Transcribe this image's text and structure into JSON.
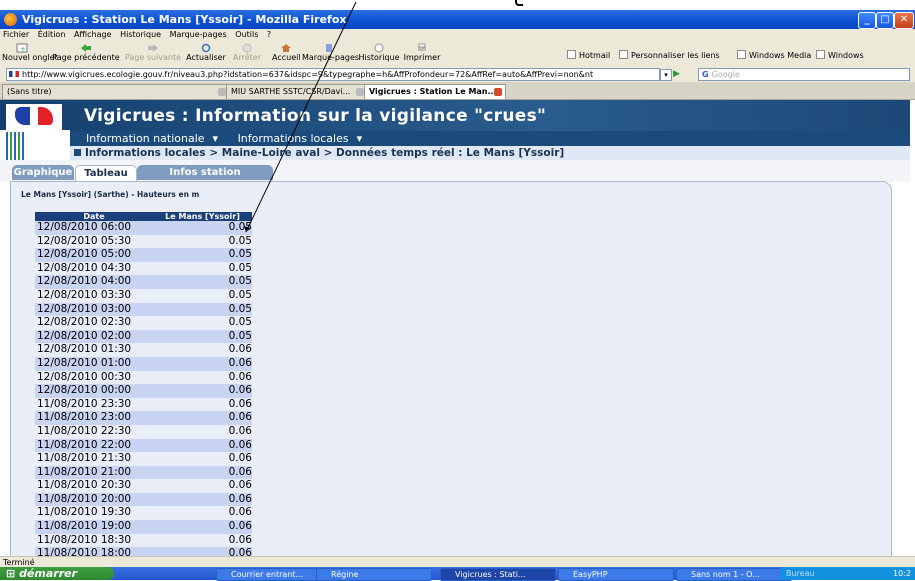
{
  "window": {
    "title": "Vigicrues : Station Le Mans [Yssoir] - Mozilla Firefox"
  },
  "menu": [
    "Fichier",
    "Édition",
    "Affichage",
    "Historique",
    "Marque-pages",
    "Outils",
    "?"
  ],
  "toolbar": {
    "new_tab": "Nouvel onglet",
    "back": "Page précédente",
    "forward": "Page suivante",
    "reload": "Actualiser",
    "stop": "Arrêter",
    "home": "Accueil",
    "bookmarks": "Marque-pages",
    "history": "Historique",
    "print": "Imprimer",
    "links": [
      "Hotmail",
      "Personnaliser les liens",
      "Windows Media",
      "Windows"
    ]
  },
  "url": "http://www.vigicrues.ecologie.gouv.fr/niveau3.php?idstation=637&idspc=9&typegraphe=h&AffProfondeur=72&AffRef=auto&AffPrevi=non&nt",
  "search_placeholder": "Google",
  "browser_tabs": [
    {
      "label": "(Sans titre)"
    },
    {
      "label": "MIU SARTHE SSTC/CSR/Davi..."
    },
    {
      "label": "Vigicrues : Station Le Man..."
    }
  ],
  "site": {
    "title": "Vigicrues : Information sur la vigilance \"crues\"",
    "nav": [
      "Information nationale",
      "Informations locales"
    ],
    "breadcrumb": "Informations locales > Maine-Loire aval > Données temps réel : Le Mans [Yssoir]",
    "page_tabs": [
      "Graphique",
      "Tableau",
      "Infos station"
    ],
    "subtitle": "Le Mans [Yssoir] (Sarthe) - Hauteurs en m",
    "table": {
      "headers": [
        "Date",
        "Le Mans [Yssoir]"
      ],
      "rows": [
        [
          "12/08/2010 06:00",
          "0.05"
        ],
        [
          "12/08/2010 05:30",
          "0.05"
        ],
        [
          "12/08/2010 05:00",
          "0.05"
        ],
        [
          "12/08/2010 04:30",
          "0.05"
        ],
        [
          "12/08/2010 04:00",
          "0.05"
        ],
        [
          "12/08/2010 03:30",
          "0.05"
        ],
        [
          "12/08/2010 03:00",
          "0.05"
        ],
        [
          "12/08/2010 02:30",
          "0.05"
        ],
        [
          "12/08/2010 02:00",
          "0.05"
        ],
        [
          "12/08/2010 01:30",
          "0.06"
        ],
        [
          "12/08/2010 01:00",
          "0.06"
        ],
        [
          "12/08/2010 00:30",
          "0.06"
        ],
        [
          "12/08/2010 00:00",
          "0.06"
        ],
        [
          "11/08/2010 23:30",
          "0.06"
        ],
        [
          "11/08/2010 23:00",
          "0.06"
        ],
        [
          "11/08/2010 22:30",
          "0.06"
        ],
        [
          "11/08/2010 22:00",
          "0.06"
        ],
        [
          "11/08/2010 21:30",
          "0.06"
        ],
        [
          "11/08/2010 21:00",
          "0.06"
        ],
        [
          "11/08/2010 20:30",
          "0.06"
        ],
        [
          "11/08/2010 20:00",
          "0.06"
        ],
        [
          "11/08/2010 19:30",
          "0.06"
        ],
        [
          "11/08/2010 19:00",
          "0.06"
        ],
        [
          "11/08/2010 18:30",
          "0.06"
        ],
        [
          "11/08/2010 18:00",
          "0.06"
        ]
      ]
    }
  },
  "status": "Terminé",
  "taskbar": {
    "start": "démarrer",
    "tasks": [
      "Courrier entrant...",
      "Régine",
      "Vigicrues : Stati...",
      "EasyPHP",
      "Sans nom 1 - O..."
    ],
    "desk": "Bureau",
    "clock": "10:2"
  }
}
